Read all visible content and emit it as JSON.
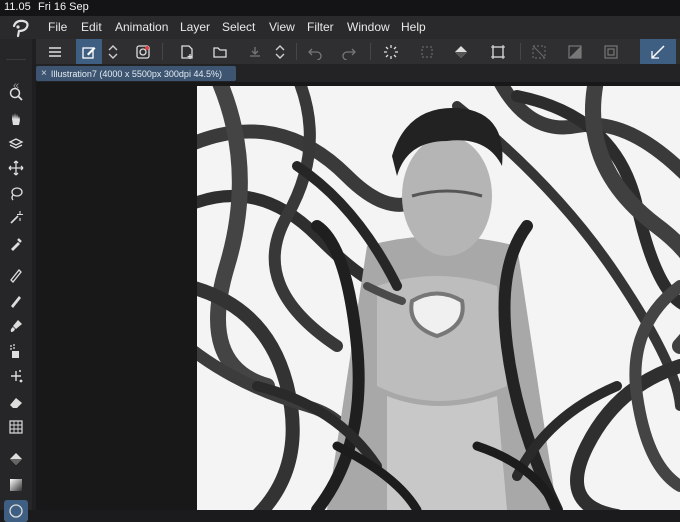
{
  "status": {
    "time": "11.05",
    "date": "Fri 16 Sep"
  },
  "menu": [
    "File",
    "Edit",
    "Animation",
    "Layer",
    "Select",
    "View",
    "Filter",
    "Window",
    "Help"
  ],
  "document": {
    "tab_label": "Illustration7 (4000 x 5500px 300dpi 44.5%)",
    "close_glyph": "×"
  },
  "toolbar": {
    "collapse_glyph": "«",
    "tools": [
      "magnifier-icon",
      "hand-icon",
      "layer-move-icon",
      "move-icon",
      "lasso-icon",
      "magic-wand-icon",
      "eyedropper-icon",
      "pen-icon",
      "pencil-icon",
      "brush-icon",
      "airbrush-icon",
      "decoration-icon",
      "eraser-icon",
      "blend-icon",
      "fill-icon",
      "gradient-icon",
      "figure-icon"
    ]
  },
  "colors": {
    "accent": "#3f5f82",
    "menubar": "#2a2a2c",
    "canvas": "#ffffff"
  }
}
